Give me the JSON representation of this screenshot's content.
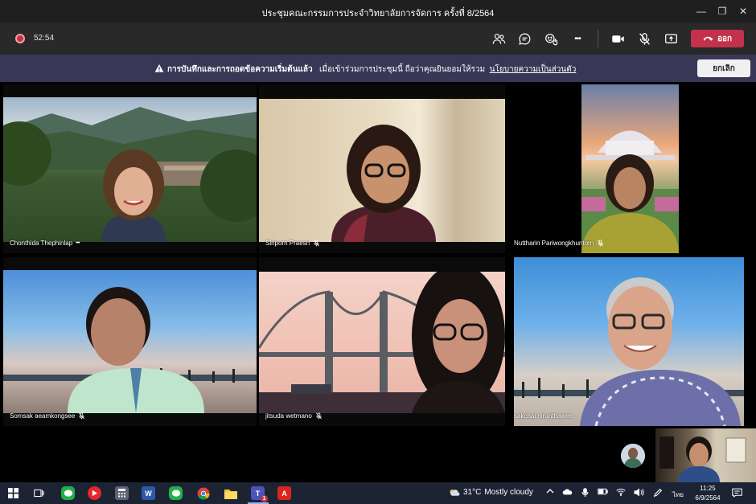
{
  "window": {
    "title": "ประชุมคณะกรรมการประจำวิทยาลัยการจัดการ ครั้งที่ 8/2564",
    "minimize_glyph": "—",
    "maximize_glyph": "❐",
    "close_glyph": "✕"
  },
  "toolbar": {
    "timer": "52:54",
    "more_glyph": "•••",
    "leave_label": "ออก"
  },
  "banner": {
    "bold_text": "การบันทึกและการถอดข้อความเริ่มต้นแล้ว",
    "text": "เมื่อเข้าร่วมการประชุมนี้ ถือว่าคุณยินยอมให้รวม",
    "link_text": "นโยบายความเป็นส่วนตัว",
    "dismiss_label": "ยกเลิก"
  },
  "participants": [
    {
      "name": "Chonthida Thephinlap",
      "status": "more",
      "more_glyph": "•••"
    },
    {
      "name": "Siriporn Praesri",
      "status": "muted"
    },
    {
      "name": "Nuttharin Pariwongkhuntorn",
      "status": "muted"
    },
    {
      "name": "Somsak aeamkongsee",
      "status": "muted"
    },
    {
      "name": "jitsuda wetmano",
      "status": "muted"
    },
    {
      "name": "sakchai nirunthawee",
      "status": "none"
    }
  ],
  "taskbar": {
    "icons": [
      "windows-start",
      "task-view",
      "line",
      "youtube",
      "calculator",
      "word",
      "line",
      "chrome",
      "file-explorer",
      "teams",
      "acrobat"
    ],
    "word_glyph": "W",
    "teams_glyph": "T",
    "teams_badge": "1",
    "acrobat_glyph": "A",
    "weather_temp": "31°C",
    "weather_text": "Mostly cloudy",
    "language": "ไทย",
    "time": "11:25",
    "date": "6/9/2564"
  },
  "colors": {
    "leave": "#c4314b",
    "banner": "#383856",
    "titlebar": "#1f1f1f",
    "controlbar": "#292929",
    "taskbar": "#1c2433"
  }
}
